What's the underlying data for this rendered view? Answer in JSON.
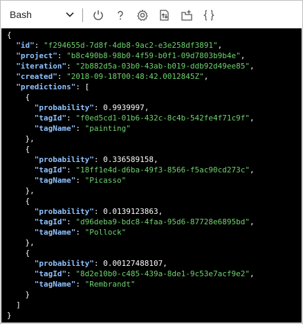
{
  "toolbar": {
    "shell": "Bash",
    "icons": [
      "chevron-down-icon",
      "power-icon",
      "help-icon",
      "gear-icon",
      "upload-download-icon",
      "open-editor-icon",
      "braces-icon"
    ]
  },
  "json": {
    "id_key": "\"id\"",
    "id_val": "\"f294655d-7d8f-4db8-9ac2-e3e258df3891\"",
    "project_key": "\"project\"",
    "project_val": "\"b8c490b8-98b0-4f59-b0f1-09d7803b9b4e\"",
    "iteration_key": "\"iteration\"",
    "iteration_val": "\"2b882d5a-03b0-43ab-b019-ddb92d49ee85\"",
    "created_key": "\"created\"",
    "created_val": "\"2018-09-18T00:48:42.0012845Z\"",
    "predictions_key": "\"predictions\"",
    "prob_key": "\"probability\"",
    "tagid_key": "\"tagId\"",
    "tagname_key": "\"tagName\"",
    "predictions": [
      {
        "probability": "0.9939997",
        "tagId": "\"f0ed5cd1-01b6-432c-8c4b-542fe4f71c9f\"",
        "tagName": "\"painting\""
      },
      {
        "probability": "0.336589158",
        "tagId": "\"18ff1e4d-d6ba-49f3-8566-f5ac90cd273c\"",
        "tagName": "\"Picasso\""
      },
      {
        "probability": "0.0139123863",
        "tagId": "\"d96deba9-bdc8-4faa-95d6-87728e6895bd\"",
        "tagName": "\"Pollock\""
      },
      {
        "probability": "0.00127488107",
        "tagId": "\"8d2e10b0-c485-439a-8de1-9c53e7acf9e2\"",
        "tagName": "\"Rembrandt\""
      }
    ]
  }
}
